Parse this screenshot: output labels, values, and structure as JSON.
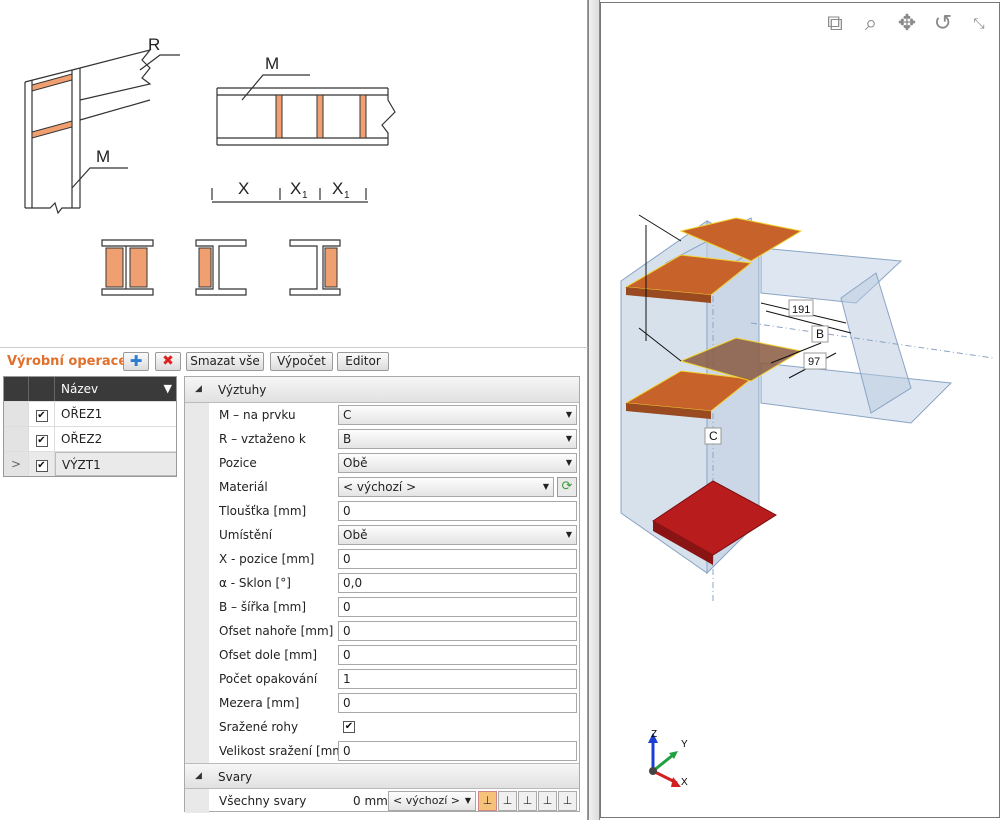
{
  "drawings": {
    "labels": {
      "r": "R",
      "m_top": "M",
      "m_left": "M",
      "x": "X",
      "x1a": "X",
      "x1b": "X",
      "sub1": "1",
      "sub2": "1"
    }
  },
  "toolbar": {
    "title": "Výrobní operace",
    "add_icon": "plus-icon",
    "delete_icon": "red-x-icon",
    "delete_all_label": "Smazat vše",
    "compute_label": "Výpočet",
    "editor_label": "Editor"
  },
  "operations": {
    "header": "Název",
    "rows": [
      {
        "name": "OŘEZ1",
        "checked": true,
        "selected": false
      },
      {
        "name": "OŘEZ2",
        "checked": true,
        "selected": false
      },
      {
        "name": "VÝZT1",
        "checked": true,
        "selected": true
      }
    ],
    "current_marker": ">"
  },
  "properties": {
    "group1": "Výztuhy",
    "fields": [
      {
        "label": "M – na prvku",
        "value": "C",
        "type": "combo"
      },
      {
        "label": "R – vztaženo k",
        "value": "B",
        "type": "combo"
      },
      {
        "label": "Pozice",
        "value": "Obě",
        "type": "combo"
      },
      {
        "label": "Materiál",
        "value": "< výchozí >",
        "type": "combo-refresh"
      },
      {
        "label": "Tloušťka [mm]",
        "value": "0",
        "type": "text"
      },
      {
        "label": "Umístění",
        "value": "Obě",
        "type": "combo"
      },
      {
        "label": "X - pozice [mm]",
        "value": "0",
        "type": "text"
      },
      {
        "label": "α - Sklon [°]",
        "value": "0,0",
        "type": "text"
      },
      {
        "label": "B – šířka [mm]",
        "value": "0",
        "type": "text"
      },
      {
        "label": "Ofset nahoře [mm]",
        "value": "0",
        "type": "text"
      },
      {
        "label": "Ofset dole [mm]",
        "value": "0",
        "type": "text"
      },
      {
        "label": "Počet opakování",
        "value": "1",
        "type": "text"
      },
      {
        "label": "Mezera [mm]",
        "value": "0",
        "type": "text"
      },
      {
        "label": "Sražené rohy",
        "value": "",
        "type": "checkbox"
      },
      {
        "label": "Velikost sražení [mm]",
        "value": "0",
        "type": "text"
      }
    ],
    "group2": "Svary",
    "welds": {
      "label": "Všechny svary",
      "size": "0 mm",
      "material": "< výchozí >"
    }
  },
  "viewer": {
    "labels": {
      "dim1": "191",
      "b": "B",
      "dim2": "97",
      "c": "C"
    },
    "axes": {
      "z": "Z",
      "y": "Y",
      "x": "X"
    },
    "tools": [
      "zoom-window-icon",
      "zoom-icon",
      "pan-icon",
      "rotate-icon",
      "fit-icon"
    ],
    "colors": {
      "stiffener": "#c8622b",
      "base_plate": "#b81c1c",
      "member": "#b7c9dd",
      "accent": "#e0702c"
    }
  }
}
